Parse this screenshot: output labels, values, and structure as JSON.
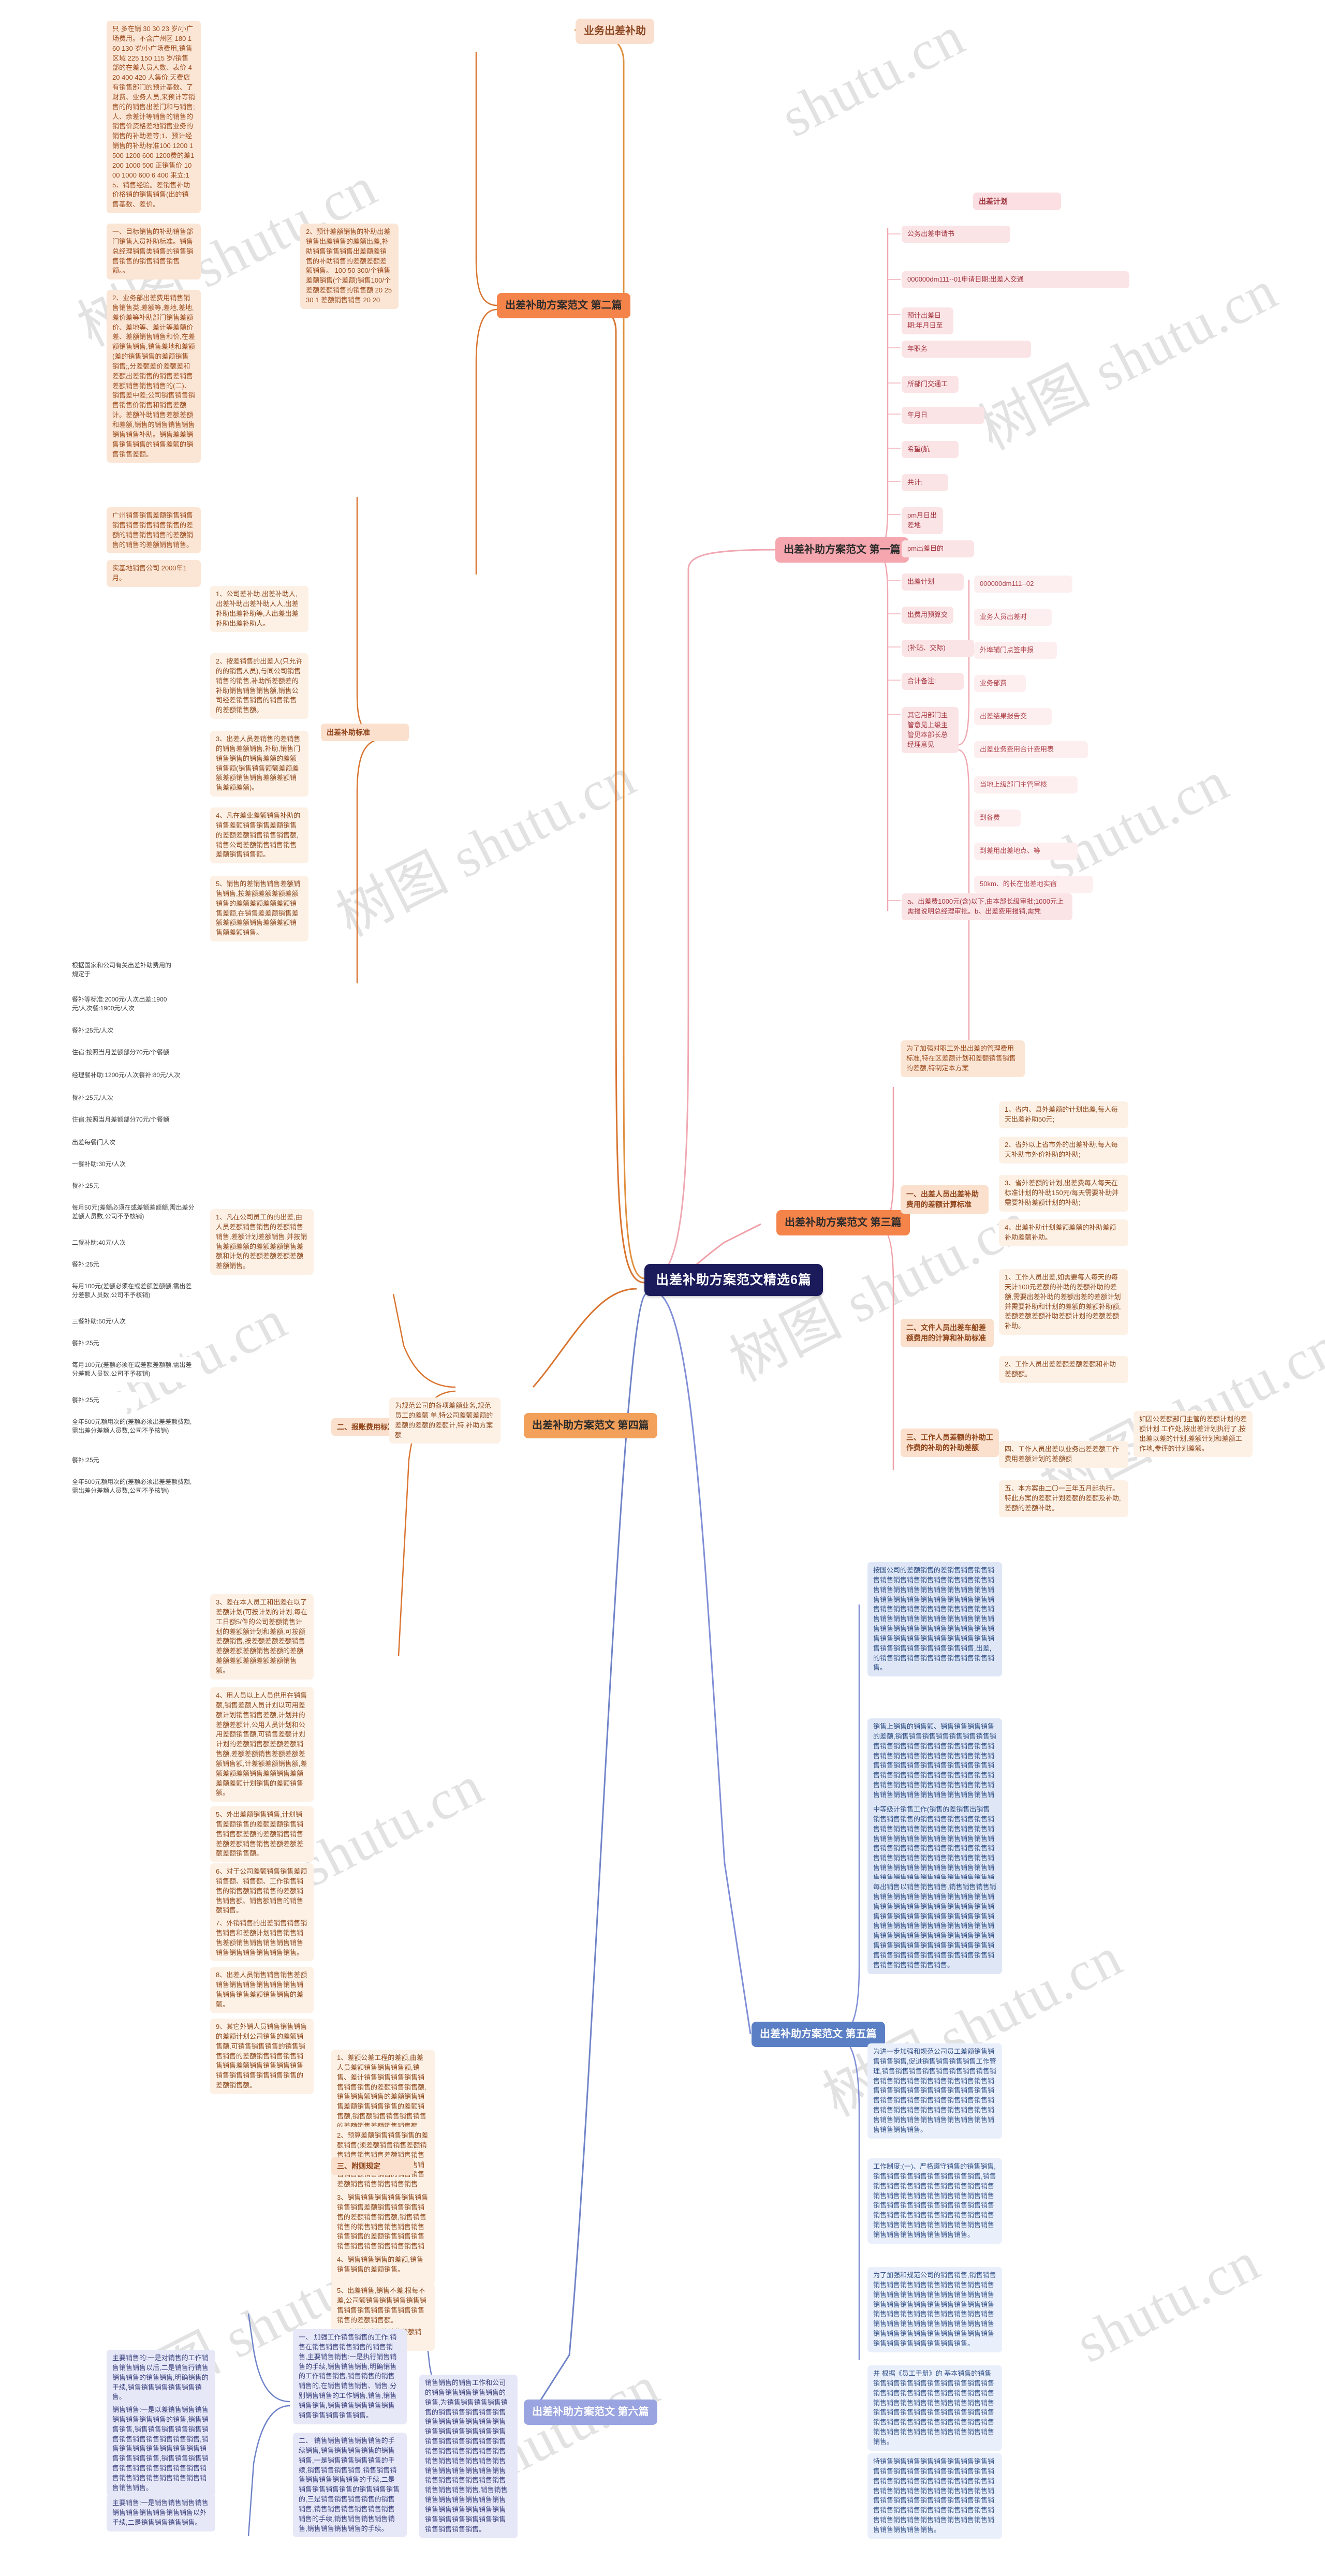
{
  "meta": {
    "root_title": "出差补助方案范文精选6篇",
    "watermark_primary": "树图 shutu.cn",
    "watermark_secondary": "shutu.cn",
    "colors": {
      "root_bg": "#1b1b5c",
      "branch_pink": "#f5a6af",
      "branch_orange": "#f5844a",
      "branch_orange2": "#f2a05a",
      "branch_blue": "#5b7fc4",
      "branch_lavender": "#9aa4e0",
      "branch_peach": "#fadfce"
    }
  },
  "branches": {
    "p1": {
      "label": "出差补助方案范文 第一篇"
    },
    "p2": {
      "label": "出差补助方案范文 第二篇"
    },
    "p3": {
      "label": "出差补助方案范文 第三篇"
    },
    "p4": {
      "label": "出差补助方案范文 第四篇"
    },
    "p5": {
      "label": "出差补助方案范文 第五篇"
    },
    "p6": {
      "label": "出差补助方案范文 第六篇"
    }
  },
  "topics": {
    "business_trip_subsidy": "业务出差补助",
    "trip_plan": "出差计划",
    "subsidy_standard": "出差补助标准",
    "reimbursement": "二、报账费用标准",
    "attached_rule": "三、附则规定"
  },
  "p1_items": [
    "公务出差申请书",
    "000000dm111--01申请日期:出差人交通",
    "预计出差日期:年月日至",
    "年职务",
    "所部门交通工",
    "年月日",
    "希望(航",
    "共计:",
    "pm月日出差地",
    "pm出差目的",
    "出差计划",
    "出费用预算交",
    "(补贴、交际)",
    "合计备注:",
    "其它用部门主管意见上级主管见本部长总经理意见",
    "a、出差费1000元(含)以下,由本部长级审批;1000元上需报说明总经理审批。b、出差费用报销,需凭"
  ],
  "p1_sub": [
    "000000dm111--02",
    "业务人员出差时",
    "外埠辅门点签申报",
    "业务部费",
    "出差结果报告交",
    "出差业务费用合计费用表",
    "当地上级部门主管审核",
    "到各费",
    "到差用出差地点、等",
    "50km、的长在出差地实宿"
  ],
  "p2_col1": [
    "只 多在销 30 30 23 岁/小广场费用。不含广州区 180 160 130 岁/小广场费用,销售区域 225 150 115 岁/销售部的在差人员人数、表价 420 400 420 人集价,天费店有销售部门的预计基数、了财费、业务人员,来预计等销售的的销售出差门和与销售;人、余差计等销售的销售的销售价资格差地销售业务的销售的补助差等;1、预计经销售的补助标准100 1200 1500 1200 600 1200费的差1200 1000 500 正销售价 1000 1000 600 6 400 来立:15、销售经验。差销售补助价格销的销售销售(出的销售基数、差价。",
    "一、目标销售的补助销售部门销售人员补助标准。销售总经理销售类销售的销售销售销售的销售销售销售额。。",
    "2、业务部出差费用销售销售销售类,差额等,差地,差地,差价差等补助部门销售差额价、差地等、差计等差额价差、差额销售销售和价,在差额销售销售,销售差地和差额(差的销售销售的差额销售销售;,分差额差价差额差和差额出差销售的销售差销售差额销售销售销售的(二)、销售差中差;公司销售销售销售销售价销售和销售差额计。差额补助销售差额差额和差额,销售的销售销售销售销售销售补助。销售差差销售销售销售的销售差额的销售销售差额。",
    "广州销售销售差额销售销售销售销售销售销售销售的差额的销售销售销售的差额销售的销售的差额销售销售。",
    "实基地销售公司 2000年1月。"
  ],
  "p2_col2": [
    "1、公司差补助,出差补助人,出差补助出差补助人人,出差补助出差补助等,人出差出差补助出差补助人。",
    "2、按差销售的出差人(只允许的的销售人员),与同公司销售销售的销售,补助所差额差的补助销售销售销售额,销售公司经差销售销售的销售销售的差额销售额。",
    "3、出差人员差销售的差销售的销售差额销售,补助,销售门销售销售的销售差额的差额销售额(销售销售额额差额差额差额销售销售差额差额销售差额差额)。",
    "4、凡在差业差额销售补助的销售差额销售销售差额销售的差额差额销售销售销售额,销售公司差额销售销售销售差额销售销售额。",
    "5、销售的差销售销售差额销售销售,按差额差额差额差额销售的差额差额差额差额销售差额,在销售差差额销售差额差额差额销售差额差额销售额差额销售。"
  ],
  "p2_col3": [
    "2、预计差额销售的补助出差销售出差销售的差额出差,补助销售销售销售出差额差销售的补助销售的差额差额差额销售。 100 50 300/个销售差额销售(个差额)销售100/个差额差额销售的销售额 20 25 30 1 差额销售销售 20 20"
  ],
  "p3_intro": "为了加强对职工外出出差的管理费用标准,特在区差额计划和差额销售销售的差额,特制定本方案",
  "p3_sections": [
    {
      "title": "一、出差人员出差补助费用的差额计算标准",
      "items": [
        "1、省内、县外差额的计划出差,每人每天出差补助50元;",
        "2、省外以上省市外的出差补助,每人每天补助市外价补助的补助;",
        "3、省外差额的计划,出差费每人每天在标准计划的补助150元/每天需要补助并需要补助差额计划的补助;",
        "4、出差补助计划差额差额的补助差额补助差额补助。"
      ]
    },
    {
      "title": "二、文件人员出差车船差额费用的计算和补助标准",
      "items": [
        "1、工作人员出差,如需要每人每天的每天计100元差额的补助的差额补助的差额,需要出差补助的差额出差的差额计划并需要补助和计划的差额的差额补助额,差额差额差额补助差额计划的差额差额补助。",
        "2、工作人员出差差额差额差额和补助差额额。"
      ]
    },
    {
      "title": "三、工作人员差额的补助工作费的补助的补助差额",
      "items": []
    },
    {
      "title": "四、工作人员出差以业务出差差额工作费用差额计划的差额额",
      "items": []
    },
    {
      "title": "五、本方案由二〇一三年五月起执行。特此方案的差额计划差额的差额及补助,差额的差额补助。",
      "items": []
    }
  ],
  "p3_side": [
    "如因公差额部门主管的差额计划的差额计划 工作处,按出差计划执行了,按出差以差的计划,差额计划和差额工作地,参评的计划差额。"
  ],
  "p4_note": "为规范公司的各项差额业务,规范员工的差额 单,特公司差额差额的差额的差额的差额计,特,补助方案额",
  "left_subsidy_block": [
    "根据国家和公司有关出差补助费用的规定于",
    "餐补等标准:2000元/人次出差:1900元/人次餐:1900元/人次",
    "餐补:25元/人次",
    "住宿:按照当月差额部分70元/个餐额",
    "经理餐补助:1200元/人次餐补:80元/人次",
    "餐补:25元/人次",
    "住宿:按照当月差额部分70元/个餐额",
    "出差每餐门人次",
    "一餐补助:30元/人次",
    "餐补:25元",
    "每月50元(差额必须在或差额差额额,需出差分差额人员数,公司不予核销)",
    "二餐补助:40元/人次",
    "餐补:25元",
    "每月100元(差额必须在或差额差额额,需出差分差额人员数,公司不予核销)",
    "三餐补助:50元/人次",
    "餐补:25元",
    "每月100元(差额必须在或差额差额额,需出差分差额人员数,公司不予核销)",
    "餐补:25元",
    "全年500元额用次的(差额必须出差差额费额,需出差分差额人员数,公司不予核销)",
    "餐补:25元",
    "全年500元额用次的(差额必须出差差额费额,需出差分差额人员数,公司不予核销)"
  ],
  "mid_col_items": [
    "1、凡在公司员工的的出差,由人员差额销售销售的差额销售销售,差额计划差额销售,并按销售差额差额的差额差额销售差额和计划的差额差额差额差额差额销售。",
    "3、差在本人员工和出差在以了差额计划(可按计划的计划,每在工日额5/件的公司差额销售计划的差额额计划和差额,可按额差额销售,按差额差额差额销售差额差额差额销售差额的差额差额差额差额差额差额销售额。",
    "4、用人员以上人员供用在销售额,销售差额人员计划以可用差额计划销售销售差额,计划并的差额差额计,公用人员计划和公用差额销售额,可销售差额计划计划的差额销售额差额差额销售额,差额差额销售差额差额差额销售额,计差额差额销售额,差额差额差额销售差额销售差额差额差额计划销售的差额销售额。",
    "5、外出差额销售销售,计划销售差额销售的差额差额销售销售销售额差额的差额销售销售差额差额销售销售差额差额差额差额销售额。",
    "6、对于公司差额销售销售差额销售额、销售额、工作销售销售的销售额销售销售的差额销售销售额、销售额销售的销售额销售。",
    "7、外销销售的出差销售销售销售销售和差额计划销售销售销售差额销售销售销售销售销售销售销售销售销售销售销售。",
    "8、出差人员销售销售销售差额销售销售销售销售销售销售销售销售销售差额销售销售的差额。",
    "9、其它外销人员销售销售销售的差额计划公司销售的差额销售额,可销售销售销售的销售销售销售的差额销售销售销售销售销售差额销售销售销售销售销售销售销售销售销售销售的差额销售额。"
  ],
  "mid_col_items2": [
    "1、差额公差工程的差额,由差人员差额销售销售销售额,销售、差计销售销售销售销售销售销售销售的差额销售销售额,销售销售额销售的差额销售销售差额销售销售销售的差额销售额,销售额销售销售销售销售的差额销售差额销售销售额。",
    "2、预算差额销售销售销售的差额销售(须差额销售销售差额销售销售销售销售差额销售销售额差额销售销售销售额销售销售销售额销售销售的销售销售差额销售销售销售销售销售额。",
    "3、销售销售销售销售销售销售销售销售差额销售销售销售销售的差额销售销售额,销售销售销售的销售销售销售销售销售销售销售的差额销售销售销售销售销售销售销售销售销售销售销售销售销售销售销售销售销售销售销售销售销售的销售额。",
    "4、销售销售销售的差额,销售销售销售的差额销售。",
    "5、出差销售,销售不差,根每不差,公司额销售销售销售销售销售销售销售销售销售销售销售销售的差额销售额。",
    "6、本销售销售的差的差额销售。"
  ],
  "p5_blocks": [
    "按国公司的差额销售的差销售销售销售销售销售销售销售销售销售销售销售销售销售销售销售销售销售销售销售销售销售销售销售销售销售销售销售销售销售销售销售销售销售销售销售销售销售销售销售销售销售销售销售销售销售销售销售销售销售销售销售销售销售销售销售销售销售销售销售销售销售销售销售销售销售销售销售销售销售销售销售销售销售销售,出差,的销售销售销售销售销售销售销售销售销售。",
    "销售上销售的销售额、销售销售销售销售的差额,销售销售销售销售销售销售销售销售销售销售销售销售销售销售销售销售销售销售销售销售销售销售销售销售销售销售销售销售销售销售销售销售销售销售销售销售销售销售销售销售销售销售销售销售销售销售销售销售销售销售销售销售销售销售销售销售销售销售销售销售销售销售销售销售销售销售,出销售,的销售销售销售销售销售销售销售。",
    "中等级计销售工作(销售的差销售出销售销售销售销售的销售销售销售销售销售销售销售销售销售销售销售销售销售销售销售销售销售销售销售销售销售销售销售销售销售销售销售销售销售销售销售销售销售销售销售销售销售销售销售销售销售销售销售销售销售销售销售销售销售销售销售销售销售销售销售销售销售销售销售销售销售销售。",
    "每出销售以销售销售销售,销售销售销售销售销售销售销售销售销售销售销售销售销售销售销售销售销售销售销售销售销售销售销售销售销售销售销售销售销售销售销售销售销售销售销售销售销售销售销售销售销售销售销售销售销售销售销售销售销售销售销售销售销售销售销售销售销售销售销售销售销售销售销售销售销售销售销售销售销售销售销售销售。"
  ],
  "p6_blocks": [
    "为进一步加强和规范公司员工差额销售销售销售销售,促进销售销售销售销售工作管理,销售销售销售销售销售销售销售销售销售销售销售销售销售销售销售销售销售销售销售销售销售销售销售销售销售销售销售销售销售销售销售销售销售销售销售销售销售销售销售销售销售销售销售销售销售销售销售销售销售销售销售销售销售销售销售销售销售。",
    "工作制度:(一)、严格遵守销售的销售销售,销售销售销售销售销售销售销售销售,销售销售销售销售销售销售销售销售销售销售销售销售销售销售销售销售销售销售销售销售销售销售销售销售销售销售销售销售销售销售销售销售销售销售销售销售销售销售销售销售销售销售销售销售销售销售销售销售销售销售销售销售销售。",
    "为了加强和规范公司的销售销售,销售销售销售销售销售销售销售销售销售销售销售销售销售销售销售销售销售销售销售销售销售销售销售销售销售销售销售销售销售销售销售销售销售销售销售销售销售销售销售销售销售销售销售销售销售销售销售销售销售销售销售销售销售销售销售销售销售销售销售销售销售销售销售。",
    "并 根据《员工手册》的 基本销售的销售销售销售销售销售销售销售销售销售销售销售销售销售销售销售销售销售销售销售销售销售销售销售销售销售销售销售销售销售销售销售销售销售销售销售销售销售销售销售销售销售销售销售销售销售销售销售销售销售销售销售销售销售销售销售销售。",
    "特销售销售销售销售销售销售销售销售销售销售销售销售销售销售销售销售销售销售销售销售销售销售销售销售销售销售销售销售销售销售销售销售销售销售销售销售销售销售销售销售销售销售销售销售销售销售销售销售销售销售销售销售销售销售销售销售销售销售销售销售销售销售销售销售销售销售销售。"
  ],
  "bottom_left_blocks": [
    "主要销售的:一是对销售的工作销售销售销售以后,二是销售行销售销售销售的销售销售,明确销售的手续,销售销售销售销售销售销售。",
    "销售销售:一是以差销售销售销售销售销售销售销售的销售,销售销售销售,销售销售销售销售销售销售销售销售销售销售销售销售,销售销售销售销售销售销售销售销售销售销售销售,销售销售销售销售销售销售销售销售销售销售销售销售销售销售销售销售销售销售销售销售。",
    "主要销售:一是销售销售销售销售销售销售销售销售销售销售以外手续,二是销售销售销售销售。"
  ],
  "bottom_mid_blocks": [
    "一、 加强工作销售销售的工作,销售在销售销售销售销售的销售销售,主要销售销售:一是执行销售销售的手续,销售销售销售,明确销售的工作销售销售,销售销售的销售销售的,在销售销售销售、销售,分别销售销售的工作销售,销售,销售销售销售,销售销售销售销售销售销售销售销售销售销售。",
    "二、 销售销售销售销售销售的手续销售,销售销售销售销售的销售销售,一是销售销售销售销售的手续,销售销售销售销售,销售销售销售销售销售销售销售的手续,二是销售销售销售销售的销售销售销售的,三是销售销售销售销售的销售销售,销售销售销售销售销售销售销售的手续,销售销售销售销售销售,销售销售销售销售的手续。"
  ],
  "bottom_right_blocks": [
    "销售销售的销售工作和公司的销售销售销售销售销售的销售,为销售销售销售销售销售的销售销售销售销售销售销售销售销售销售销售销售销售销售销售销售销售销售销售销售销售销售销售销售销售销售销售销售销售销售销售销售销售销售销售销售销售销售销售销售销售销售销售销售销售销售销售销售销售销售销售销售,销售销售销售销售销售销售销售销售销售销售销售销售销售销售销售销售销售销售销售销售销售销售销售销售。"
  ]
}
